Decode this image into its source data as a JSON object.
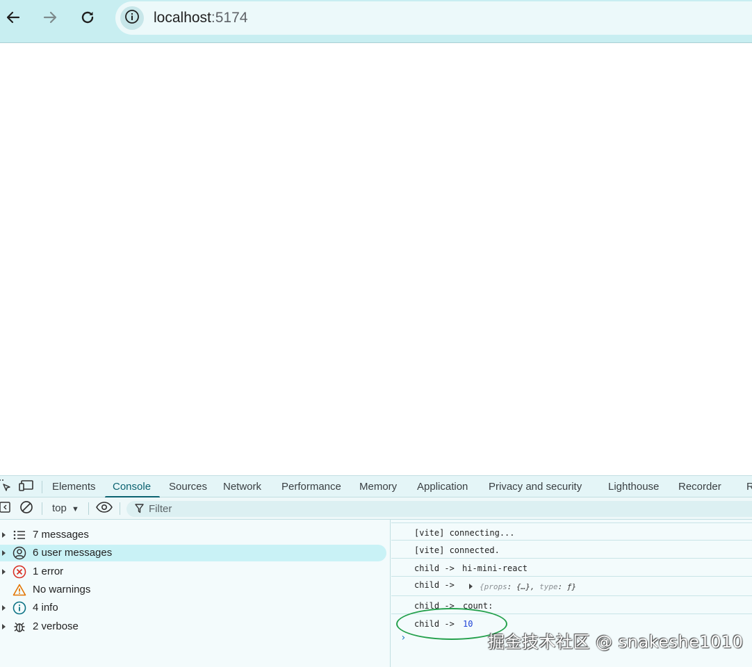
{
  "browser": {
    "url_host": "localhost",
    "url_port": ":5174"
  },
  "devtools": {
    "tabs": [
      "Elements",
      "Console",
      "Sources",
      "Network",
      "Performance",
      "Memory",
      "Application",
      "Privacy and security",
      "Lighthouse",
      "Recorder",
      "R"
    ],
    "active_tab": "Console",
    "toolbar": {
      "context": "top",
      "filter_placeholder": "Filter"
    },
    "sidebar": [
      {
        "label": "7 messages",
        "icon": "list-icon",
        "expandable": true,
        "selected": false
      },
      {
        "label": "6 user messages",
        "icon": "user-icon",
        "expandable": true,
        "selected": true
      },
      {
        "label": "1 error",
        "icon": "error-icon",
        "expandable": true,
        "selected": false
      },
      {
        "label": "No warnings",
        "icon": "warning-icon",
        "expandable": false,
        "selected": false
      },
      {
        "label": "4 info",
        "icon": "info-icon",
        "expandable": true,
        "selected": false
      },
      {
        "label": "2 verbose",
        "icon": "bug-icon",
        "expandable": true,
        "selected": false
      }
    ],
    "console": {
      "messages": [
        {
          "prefix": "[vite] connecting...",
          "value": ""
        },
        {
          "prefix": "[vite] connected.",
          "value": ""
        },
        {
          "prefix": "child ->",
          "value": "hi-mini-react"
        },
        {
          "prefix": "child ->",
          "object_preview": {
            "k1": "props",
            "v1": ": {…}, ",
            "k2": "type",
            "v2": ": ƒ}"
          }
        },
        {
          "prefix": "child ->",
          "value": "count:"
        },
        {
          "prefix": "child ->",
          "value": "10"
        }
      ],
      "prompt": "›"
    }
  },
  "watermark": "掘金技术社区 @ snakeshe1010",
  "colors": {
    "toolbar_bg": "#c8eef1",
    "accent": "#0b6270",
    "selected_bg": "#c9f2f6",
    "number_blue": "#1a3fd6",
    "annotation_green": "#23a04b"
  }
}
